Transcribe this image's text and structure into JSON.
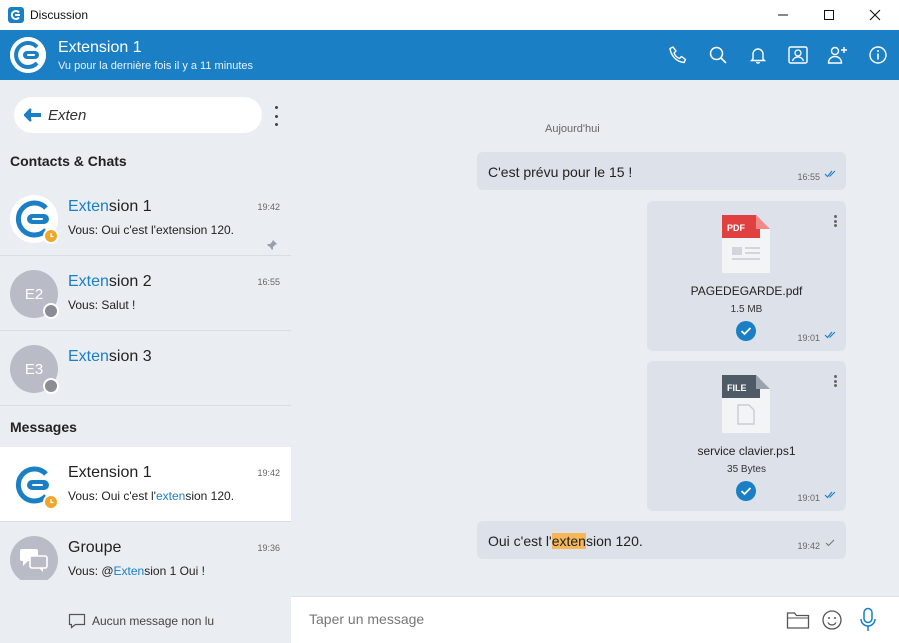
{
  "window": {
    "title": "Discussion"
  },
  "header": {
    "name": "Extension 1",
    "status": "Vu pour la dernière fois il y a 11 minutes"
  },
  "search": {
    "value": "Exten"
  },
  "sections": {
    "contacts": "Contacts & Chats",
    "messages": "Messages"
  },
  "contacts": [
    {
      "name_hl": "Exten",
      "name_rest": "sion 1",
      "preview": "Vous: Oui c'est l'extension 120.",
      "time": "19:42",
      "pinned": true
    },
    {
      "initials": "E2",
      "name_hl": "Exten",
      "name_rest": "sion 2",
      "preview": "Vous: Salut !",
      "time": "16:55"
    },
    {
      "initials": "E3",
      "name_hl": "Exten",
      "name_rest": "sion 3"
    }
  ],
  "messages": [
    {
      "name": "Extension 1",
      "preview_pre": "Vous: Oui c'est l'",
      "preview_hl": "exten",
      "preview_post": "sion 120.",
      "time": "19:42"
    },
    {
      "name": "Groupe",
      "preview_pre": "Vous: @",
      "preview_hl": "Exten",
      "preview_post": "sion 1 Oui !",
      "time": "19:36"
    }
  ],
  "footer": {
    "unread": "Aucun message non lu"
  },
  "chat": {
    "day": "Aujourd'hui",
    "msg1": {
      "text": "C'est prévu pour le 15 !",
      "time": "16:55"
    },
    "file1": {
      "type": "PDF",
      "name": "PAGEDEGARDE.pdf",
      "size": "1.5 MB",
      "time": "19:01"
    },
    "file2": {
      "type": "FILE",
      "name": "service clavier.ps1",
      "size": "35 Bytes",
      "time": "19:01"
    },
    "msg2": {
      "pre": "Oui c'est l'",
      "hl": "exten",
      "post": "sion 120.",
      "time": "19:42"
    }
  },
  "composer": {
    "placeholder": "Taper un message"
  },
  "colors": {
    "brand": "#1a7fc5",
    "away": "#f0a62b",
    "offline": "#8a8d96",
    "highlight": "#f5b75a"
  }
}
